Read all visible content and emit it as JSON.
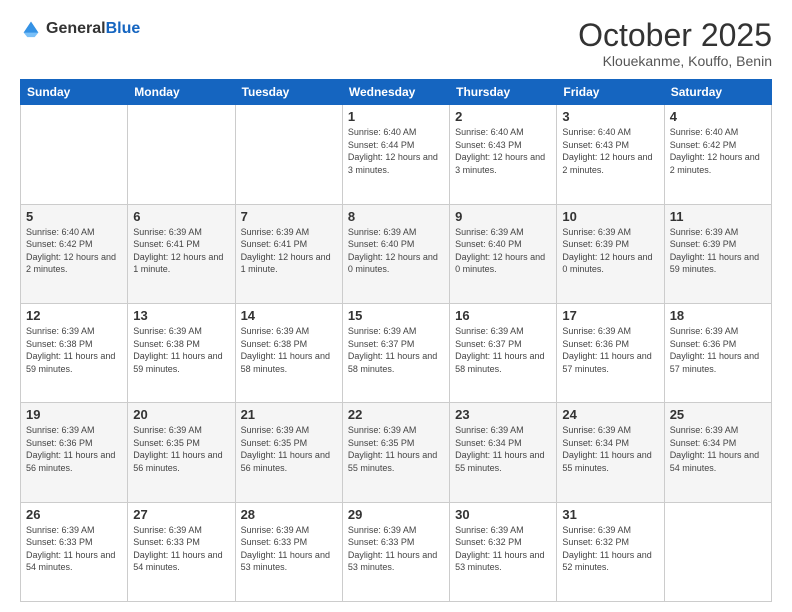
{
  "header": {
    "logo_general": "General",
    "logo_blue": "Blue",
    "title": "October 2025",
    "subtitle": "Klouekanme, Kouffo, Benin"
  },
  "calendar": {
    "days": [
      "Sunday",
      "Monday",
      "Tuesday",
      "Wednesday",
      "Thursday",
      "Friday",
      "Saturday"
    ],
    "weeks": [
      [
        {
          "day": "",
          "sunrise": "",
          "sunset": "",
          "daylight": ""
        },
        {
          "day": "",
          "sunrise": "",
          "sunset": "",
          "daylight": ""
        },
        {
          "day": "",
          "sunrise": "",
          "sunset": "",
          "daylight": ""
        },
        {
          "day": "1",
          "sunrise": "Sunrise: 6:40 AM",
          "sunset": "Sunset: 6:44 PM",
          "daylight": "Daylight: 12 hours and 3 minutes."
        },
        {
          "day": "2",
          "sunrise": "Sunrise: 6:40 AM",
          "sunset": "Sunset: 6:43 PM",
          "daylight": "Daylight: 12 hours and 3 minutes."
        },
        {
          "day": "3",
          "sunrise": "Sunrise: 6:40 AM",
          "sunset": "Sunset: 6:43 PM",
          "daylight": "Daylight: 12 hours and 2 minutes."
        },
        {
          "day": "4",
          "sunrise": "Sunrise: 6:40 AM",
          "sunset": "Sunset: 6:42 PM",
          "daylight": "Daylight: 12 hours and 2 minutes."
        }
      ],
      [
        {
          "day": "5",
          "sunrise": "Sunrise: 6:40 AM",
          "sunset": "Sunset: 6:42 PM",
          "daylight": "Daylight: 12 hours and 2 minutes."
        },
        {
          "day": "6",
          "sunrise": "Sunrise: 6:39 AM",
          "sunset": "Sunset: 6:41 PM",
          "daylight": "Daylight: 12 hours and 1 minute."
        },
        {
          "day": "7",
          "sunrise": "Sunrise: 6:39 AM",
          "sunset": "Sunset: 6:41 PM",
          "daylight": "Daylight: 12 hours and 1 minute."
        },
        {
          "day": "8",
          "sunrise": "Sunrise: 6:39 AM",
          "sunset": "Sunset: 6:40 PM",
          "daylight": "Daylight: 12 hours and 0 minutes."
        },
        {
          "day": "9",
          "sunrise": "Sunrise: 6:39 AM",
          "sunset": "Sunset: 6:40 PM",
          "daylight": "Daylight: 12 hours and 0 minutes."
        },
        {
          "day": "10",
          "sunrise": "Sunrise: 6:39 AM",
          "sunset": "Sunset: 6:39 PM",
          "daylight": "Daylight: 12 hours and 0 minutes."
        },
        {
          "day": "11",
          "sunrise": "Sunrise: 6:39 AM",
          "sunset": "Sunset: 6:39 PM",
          "daylight": "Daylight: 11 hours and 59 minutes."
        }
      ],
      [
        {
          "day": "12",
          "sunrise": "Sunrise: 6:39 AM",
          "sunset": "Sunset: 6:38 PM",
          "daylight": "Daylight: 11 hours and 59 minutes."
        },
        {
          "day": "13",
          "sunrise": "Sunrise: 6:39 AM",
          "sunset": "Sunset: 6:38 PM",
          "daylight": "Daylight: 11 hours and 59 minutes."
        },
        {
          "day": "14",
          "sunrise": "Sunrise: 6:39 AM",
          "sunset": "Sunset: 6:38 PM",
          "daylight": "Daylight: 11 hours and 58 minutes."
        },
        {
          "day": "15",
          "sunrise": "Sunrise: 6:39 AM",
          "sunset": "Sunset: 6:37 PM",
          "daylight": "Daylight: 11 hours and 58 minutes."
        },
        {
          "day": "16",
          "sunrise": "Sunrise: 6:39 AM",
          "sunset": "Sunset: 6:37 PM",
          "daylight": "Daylight: 11 hours and 58 minutes."
        },
        {
          "day": "17",
          "sunrise": "Sunrise: 6:39 AM",
          "sunset": "Sunset: 6:36 PM",
          "daylight": "Daylight: 11 hours and 57 minutes."
        },
        {
          "day": "18",
          "sunrise": "Sunrise: 6:39 AM",
          "sunset": "Sunset: 6:36 PM",
          "daylight": "Daylight: 11 hours and 57 minutes."
        }
      ],
      [
        {
          "day": "19",
          "sunrise": "Sunrise: 6:39 AM",
          "sunset": "Sunset: 6:36 PM",
          "daylight": "Daylight: 11 hours and 56 minutes."
        },
        {
          "day": "20",
          "sunrise": "Sunrise: 6:39 AM",
          "sunset": "Sunset: 6:35 PM",
          "daylight": "Daylight: 11 hours and 56 minutes."
        },
        {
          "day": "21",
          "sunrise": "Sunrise: 6:39 AM",
          "sunset": "Sunset: 6:35 PM",
          "daylight": "Daylight: 11 hours and 56 minutes."
        },
        {
          "day": "22",
          "sunrise": "Sunrise: 6:39 AM",
          "sunset": "Sunset: 6:35 PM",
          "daylight": "Daylight: 11 hours and 55 minutes."
        },
        {
          "day": "23",
          "sunrise": "Sunrise: 6:39 AM",
          "sunset": "Sunset: 6:34 PM",
          "daylight": "Daylight: 11 hours and 55 minutes."
        },
        {
          "day": "24",
          "sunrise": "Sunrise: 6:39 AM",
          "sunset": "Sunset: 6:34 PM",
          "daylight": "Daylight: 11 hours and 55 minutes."
        },
        {
          "day": "25",
          "sunrise": "Sunrise: 6:39 AM",
          "sunset": "Sunset: 6:34 PM",
          "daylight": "Daylight: 11 hours and 54 minutes."
        }
      ],
      [
        {
          "day": "26",
          "sunrise": "Sunrise: 6:39 AM",
          "sunset": "Sunset: 6:33 PM",
          "daylight": "Daylight: 11 hours and 54 minutes."
        },
        {
          "day": "27",
          "sunrise": "Sunrise: 6:39 AM",
          "sunset": "Sunset: 6:33 PM",
          "daylight": "Daylight: 11 hours and 54 minutes."
        },
        {
          "day": "28",
          "sunrise": "Sunrise: 6:39 AM",
          "sunset": "Sunset: 6:33 PM",
          "daylight": "Daylight: 11 hours and 53 minutes."
        },
        {
          "day": "29",
          "sunrise": "Sunrise: 6:39 AM",
          "sunset": "Sunset: 6:33 PM",
          "daylight": "Daylight: 11 hours and 53 minutes."
        },
        {
          "day": "30",
          "sunrise": "Sunrise: 6:39 AM",
          "sunset": "Sunset: 6:32 PM",
          "daylight": "Daylight: 11 hours and 53 minutes."
        },
        {
          "day": "31",
          "sunrise": "Sunrise: 6:39 AM",
          "sunset": "Sunset: 6:32 PM",
          "daylight": "Daylight: 11 hours and 52 minutes."
        },
        {
          "day": "",
          "sunrise": "",
          "sunset": "",
          "daylight": ""
        }
      ]
    ]
  }
}
